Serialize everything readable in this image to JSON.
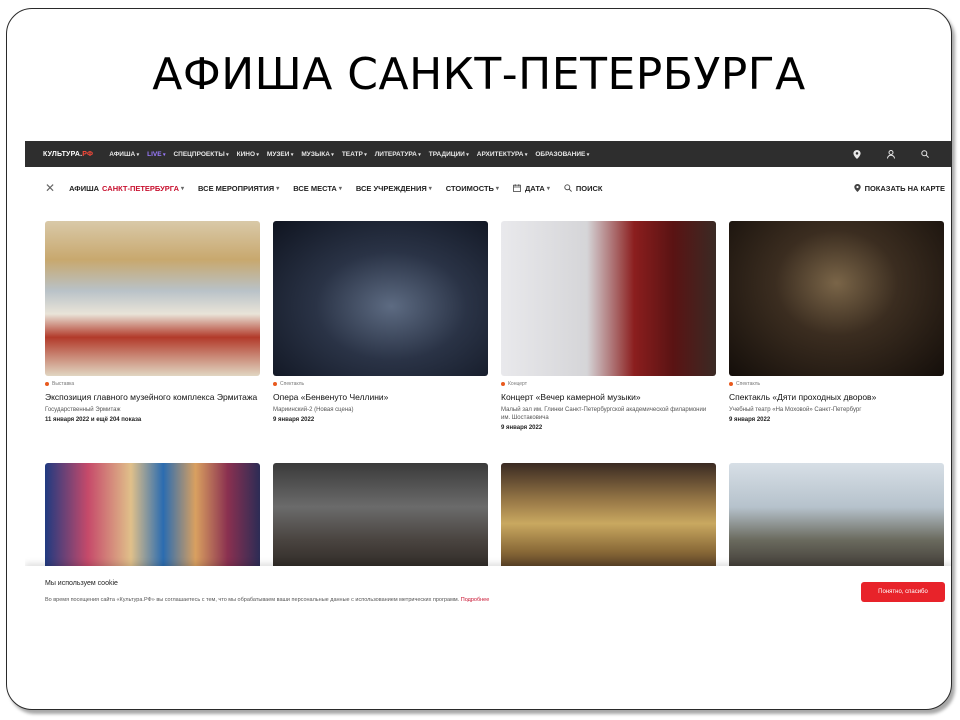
{
  "slide": {
    "title": "АФИША САНКТ-ПЕТЕРБУРГА"
  },
  "nav": {
    "logo_main": "КУЛЬТУРА.",
    "logo_suffix": "РФ",
    "items": [
      "АФИША",
      "LIVE",
      "СПЕЦПРОЕКТЫ",
      "КИНО",
      "МУЗЕИ",
      "МУЗЫКА",
      "ТЕАТР",
      "ЛИТЕРАТУРА",
      "ТРАДИЦИИ",
      "АРХИТЕКТУРА",
      "ОБРАЗОВАНИЕ"
    ]
  },
  "filters": {
    "afisha_label": "АФИША",
    "city": "САНКТ-ПЕТЕРБУРГА",
    "all_events": "ВСЕ МЕРОПРИЯТИЯ",
    "all_places": "ВСЕ МЕСТА",
    "all_institutions": "ВСЕ УЧРЕЖДЕНИЯ",
    "cost": "СТОИМОСТЬ",
    "date": "ДАТА",
    "search": "ПОИСК",
    "show_map": "ПОКАЗАТЬ НА КАРТЕ"
  },
  "cards": [
    {
      "category": "Выставка",
      "title": "Экспозиция главного музейного комплекса Эрмитажа",
      "place": "Государственный Эрмитаж",
      "date": "11 января 2022 и ещё 204 показа"
    },
    {
      "category": "Спектакль",
      "title": "Опера «Бенвенуто Челлини»",
      "place": "Мариинский-2 (Новая сцена)",
      "date": "9 января 2022"
    },
    {
      "category": "Концерт",
      "title": "Концерт «Вечер камерной музыки»",
      "place": "Малый зал им. Глинки Санкт-Петербургской академической филармонии им. Шостаковича",
      "date": "9 января 2022"
    },
    {
      "category": "Спектакль",
      "title": "Спектакль «Дяти проходных дворов»",
      "place": "Учебный театр «На Моховой» Санкт-Петербург",
      "date": "9 января 2022"
    }
  ],
  "cookie": {
    "title": "Мы используем cookie",
    "text": "Во время посещения сайта «Культура.РФ» вы соглашаетесь с тем, что мы обрабатываем ваши персональные данные с использованием метрических программ.",
    "more": "Подробнее",
    "button": "Понятно, спасибо"
  }
}
